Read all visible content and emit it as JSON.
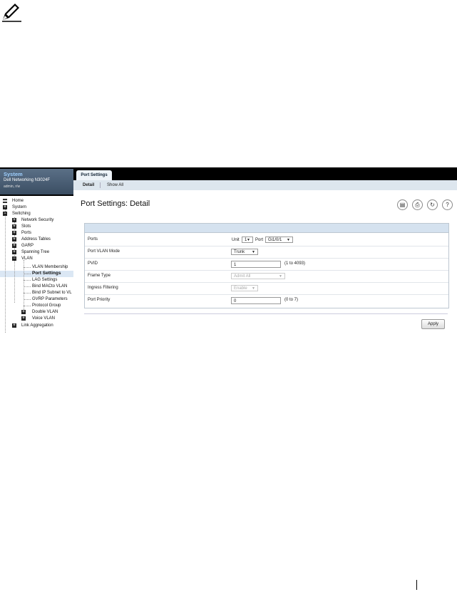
{
  "nav": {
    "brand_title": "System",
    "brand_model": "Dell Networking N3024F",
    "brand_user": "admin, r/w",
    "items": [
      {
        "label": "Home"
      },
      {
        "label": "System"
      },
      {
        "label": "Switching"
      },
      {
        "label": "Network Security"
      },
      {
        "label": "Slots"
      },
      {
        "label": "Ports"
      },
      {
        "label": "Address Tables"
      },
      {
        "label": "GARP"
      },
      {
        "label": "Spanning Tree"
      },
      {
        "label": "VLAN"
      },
      {
        "label": "VLAN Membership"
      },
      {
        "label": "Port Settings"
      },
      {
        "label": "LAG Settings"
      },
      {
        "label": "Bind MACto VLAN"
      },
      {
        "label": "Bind IP Subnet to VL"
      },
      {
        "label": "GVRP Parameters"
      },
      {
        "label": "Protocol Group"
      },
      {
        "label": "Double VLAN"
      },
      {
        "label": "Voice VLAN"
      },
      {
        "label": "Link Aggregation"
      }
    ]
  },
  "tabs": {
    "main": "Port Settings",
    "sub": [
      "Detail",
      "Show All"
    ]
  },
  "page": {
    "title": "Port Settings: Detail"
  },
  "toolbar_icons": [
    "save-icon",
    "print-icon",
    "refresh-icon",
    "help-icon"
  ],
  "form": {
    "ports_label": "Ports",
    "unit_label": "Unit",
    "unit_value": "1",
    "port_label": "Port",
    "port_value": "Gi1/0/1",
    "vlan_mode_label": "Port VLAN Mode",
    "vlan_mode_value": "Trunk",
    "pvid_label": "PVID",
    "pvid_value": "1",
    "pvid_range": "(1 to 4093)",
    "frame_type_label": "Frame Type",
    "frame_type_value": "Admit All",
    "ingress_label": "Ingress Filtering",
    "ingress_value": "Enable",
    "priority_label": "Port Priority",
    "priority_value": "0",
    "priority_range": "(0 to 7)"
  },
  "apply_label": "Apply"
}
